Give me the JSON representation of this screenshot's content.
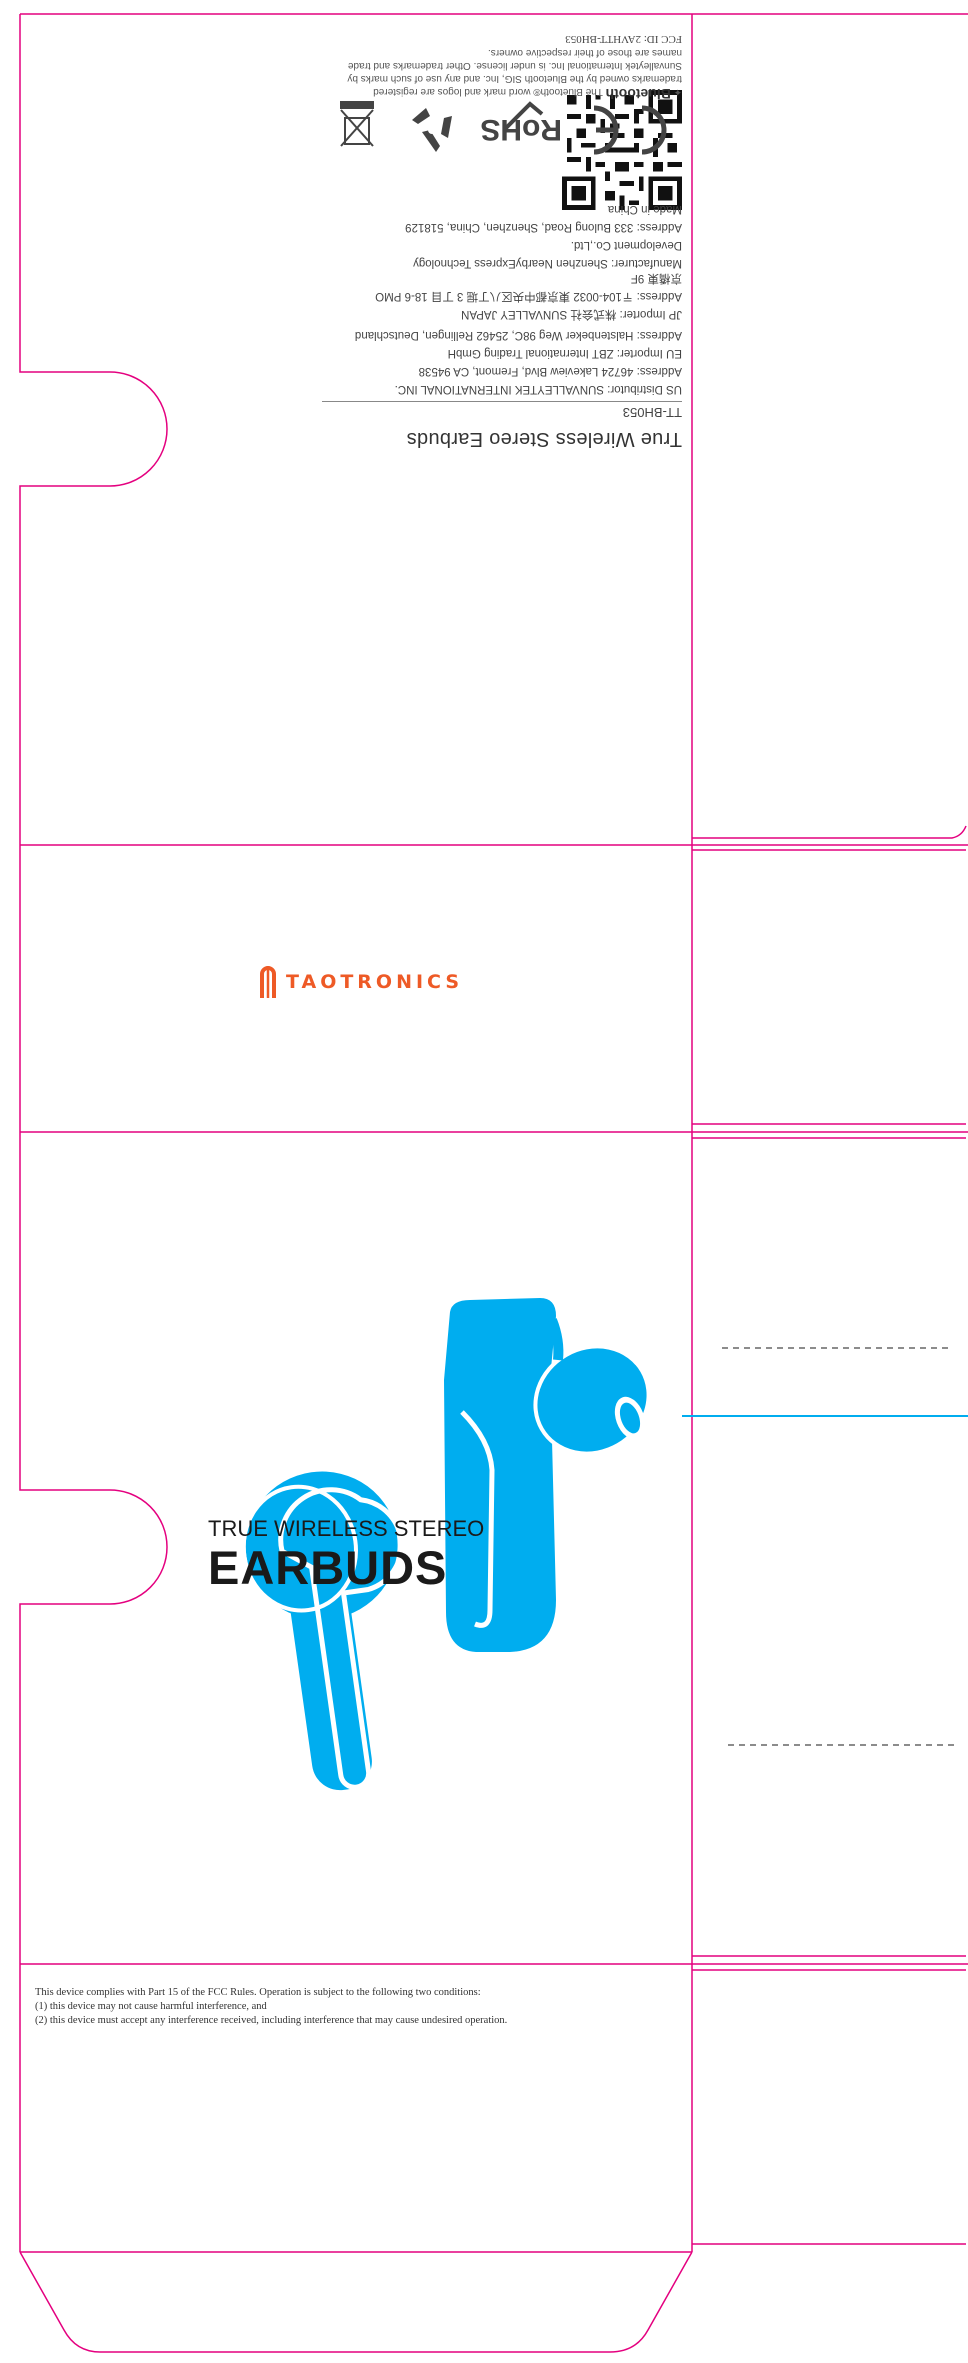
{
  "brand": {
    "name": "TAOTRONICS",
    "color": "#ee5a26"
  },
  "colors": {
    "dieline": "#e4007f",
    "product": "#00adef"
  },
  "label": {
    "product_title": "True Wireless Stereo Earbuds",
    "model": "TT-BH053",
    "lines": [
      "US Distributor: SUNVALLEYTEK INTERNATIONAL INC.",
      "Address: 46724 Lakeview Blvd, Fremont, CA 94538",
      "EU Importer: ZBT International Trading GmbH",
      "Address: Halstenbeker Weg 98C, 25462 Rellingen, Deutschland",
      "JP Importer: 株式会社 SUNVALLEY JAPAN",
      "Address: 〒104-0032 東京都中央区八丁堀 3 丁目 18-6 PMO",
      "京橋東 9F",
      "Manufacturer: Shenzhen NearbyExpress Technology",
      "Development Co.,Ltd.",
      "Address: 333 Bulong Road, Shenzhen, China, 518129",
      "Made in China"
    ],
    "marks": {
      "ce": "CE",
      "rohs": "RoHS"
    },
    "bluetooth": {
      "logo": "Bluetooth",
      "text_1": "The Bluetooth® word mark and logos are registered trademarks owned by the",
      "text_2": "Bluetooth SIG, Inc. and any use of such marks by Sunvalleytek International Inc. is under license. Other",
      "text_3": "trademarks and trade names are those of their respective owners."
    },
    "fcc_id": "FCC ID: 2AVHTT-BH053"
  },
  "front": {
    "headline_small": "TRUE WIRELESS STEREO",
    "headline_big": "EARBUDS"
  },
  "fcc": {
    "line_1": "This device complies with Part 15 of the FCC Rules. Operation is subject to the following two conditions:",
    "line_2": "(1) this device may not cause harmful interference, and",
    "line_3": "(2) this device must accept any interference received, including interference that may cause undesired operation."
  },
  "icons": [
    "qr-code-icon",
    "ce-mark-icon",
    "rohs-icon",
    "recycle-icon",
    "weee-bin-icon",
    "bluetooth-icon",
    "taotronics-logo-icon",
    "earbud-illustration"
  ]
}
